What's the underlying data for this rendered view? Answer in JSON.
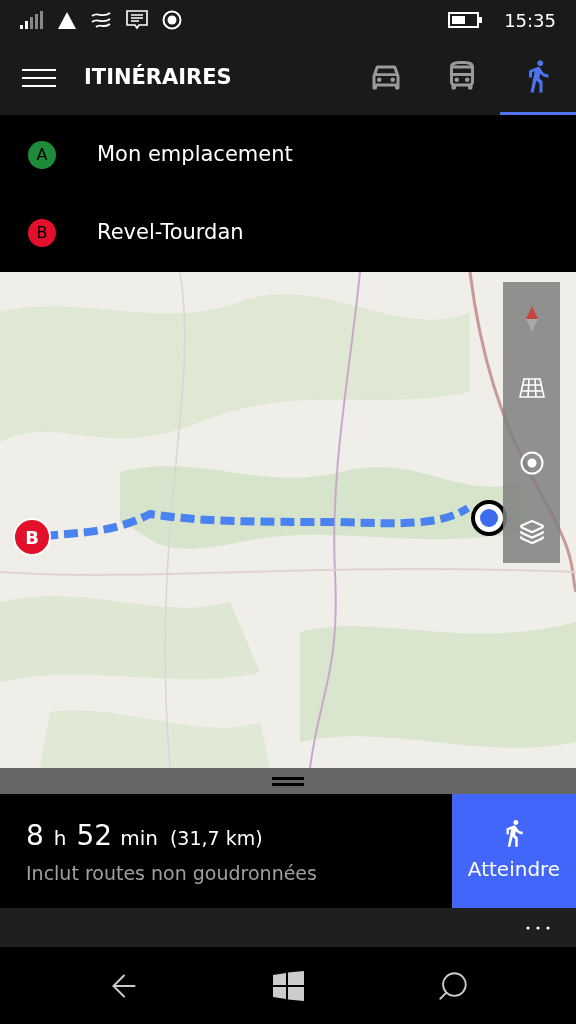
{
  "status_bar": {
    "time": "15:35"
  },
  "header": {
    "title": "ITINÉRAIRES",
    "modes": [
      {
        "kind": "car",
        "selected": false
      },
      {
        "kind": "bus",
        "selected": false
      },
      {
        "kind": "walk",
        "selected": true
      }
    ]
  },
  "waypoints": [
    {
      "letter": "A",
      "label": "Mon emplacement",
      "color": "#1e8b3a"
    },
    {
      "letter": "B",
      "label": "Revel-Tourdan",
      "color": "#e3102b"
    }
  ],
  "map": {
    "destination_marker": "B"
  },
  "summary": {
    "hours": "8",
    "hours_unit": "h",
    "minutes": "52",
    "minutes_unit": "min",
    "distance": "(31,7 km)",
    "note": "Inclut routes non goudronnées",
    "go_button": "Atteindre"
  }
}
